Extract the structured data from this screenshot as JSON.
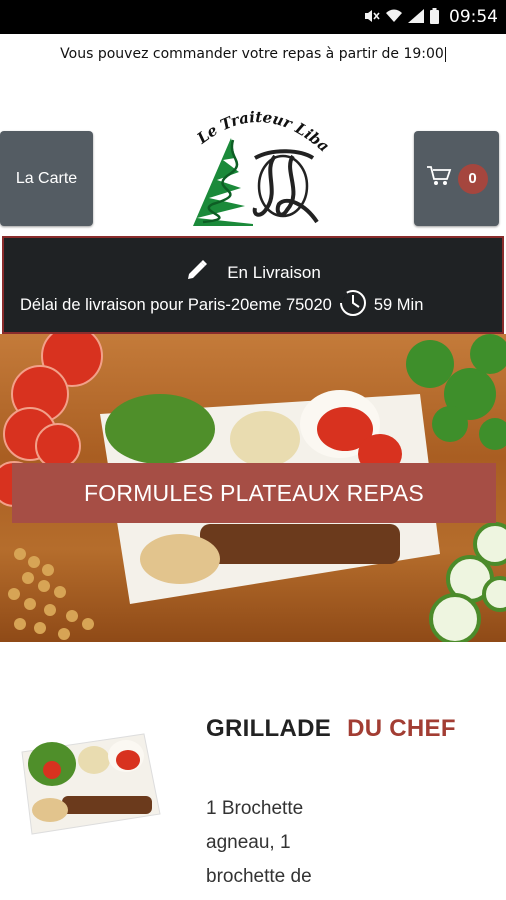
{
  "status_bar": {
    "time": "09:54",
    "icons": [
      "mute-icon",
      "wifi-icon",
      "signal-icon",
      "battery-icon"
    ]
  },
  "notice": "Vous pouvez commander votre repas à partir de 19:00",
  "header": {
    "menu_button_label": "La Carte",
    "cart_count": "0",
    "logo_text": "Le Traiteur Libanais"
  },
  "delivery": {
    "mode": "En Livraison",
    "delay_label": "Délai de livraison pour Paris-20eme 75020",
    "delay_time": "59 Min"
  },
  "banner": {
    "title": "FORMULES PLATEAUX REPAS"
  },
  "product": {
    "title_part1": "GRILLADE",
    "title_part2": "DU CHEF",
    "description": "1 Brochette agneau, 1 brochette de"
  },
  "colors": {
    "accent": "#a64e45",
    "button": "#545c63",
    "dark_bar": "#1f2224"
  }
}
